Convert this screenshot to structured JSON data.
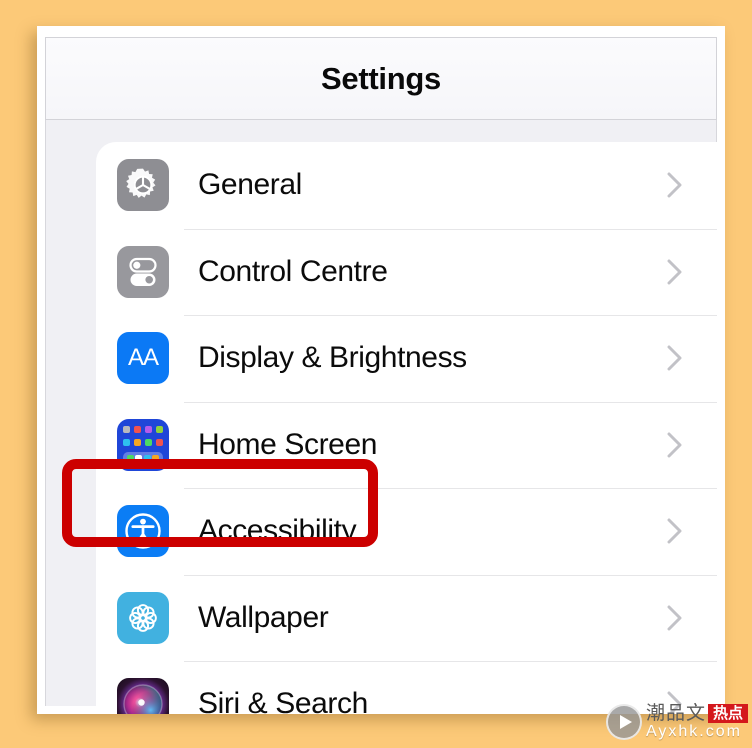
{
  "colors": {
    "background": "#fcc978",
    "card": "#ffffff",
    "list_background": "#f0f0f4",
    "highlight": "#cc0000",
    "accent_blue": "#0b7df5",
    "chevron_gray": "#c7c7cc"
  },
  "header": {
    "title": "Settings"
  },
  "settings": {
    "rows": [
      {
        "label": "General",
        "icon": "gear-icon",
        "icon_class": "icon-general",
        "chevron": "chevron-right-icon"
      },
      {
        "label": "Control Centre",
        "icon": "toggles-icon",
        "icon_class": "icon-control",
        "chevron": "chevron-right-icon"
      },
      {
        "label": "Display & Brightness",
        "icon": "aa-text-icon",
        "icon_class": "icon-display",
        "icon_text": "AA",
        "chevron": "chevron-right-icon"
      },
      {
        "label": "Home Screen",
        "icon": "app-grid-icon",
        "icon_class": "icon-home",
        "chevron": "chevron-right-icon"
      },
      {
        "label": "Accessibility",
        "icon": "accessibility-person-icon",
        "icon_class": "icon-access",
        "chevron": "chevron-right-icon",
        "highlighted": true
      },
      {
        "label": "Wallpaper",
        "icon": "flower-mandala-icon",
        "icon_class": "icon-wallpaper",
        "chevron": "chevron-right-icon"
      },
      {
        "label": "Siri & Search",
        "icon": "siri-orb-icon",
        "icon_class": "icon-siri",
        "chevron": "chevron-right-icon"
      }
    ]
  },
  "home_icon_dots": {
    "row1": [
      "#b9b9be",
      "#f0534f",
      "#b55bea",
      "#8fd13f"
    ],
    "row2": [
      "#2ec0ef",
      "#f5a623",
      "#4cd964",
      "#f0534f"
    ],
    "dock": [
      "#4cd964",
      "#ffffff",
      "#2ec0ef",
      "#f5a623"
    ]
  },
  "watermark": {
    "play_icon": "play-circle-icon",
    "chinese_text": "潮品文",
    "badge_text": "热点",
    "url": "Ayxhk.com"
  }
}
